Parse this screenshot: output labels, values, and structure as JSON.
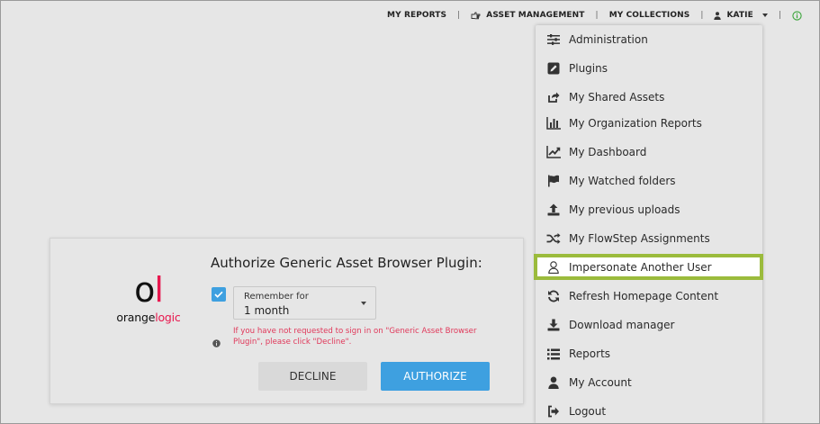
{
  "topnav": {
    "my_reports": "MY REPORTS",
    "asset_management": "ASSET MANAGEMENT",
    "my_collections": "MY COLLECTIONS",
    "user": "KATIE",
    "separator": "|"
  },
  "menu": {
    "items": [
      {
        "label": "Administration",
        "icon": "sliders-icon"
      },
      {
        "label": "Plugins",
        "icon": "pencil-icon"
      },
      {
        "label": "My Shared Assets",
        "icon": "share-icon"
      },
      {
        "label": "My Organization Reports",
        "icon": "bar-chart-icon"
      },
      {
        "label": "My Dashboard",
        "icon": "line-chart-icon"
      },
      {
        "label": "My Watched folders",
        "icon": "flag-icon"
      },
      {
        "label": "My previous uploads",
        "icon": "upload-icon"
      },
      {
        "label": "My FlowStep Assignments",
        "icon": "shuffle-icon"
      },
      {
        "label": "Impersonate Another User",
        "icon": "user-outline-icon"
      },
      {
        "label": "Refresh Homepage Content",
        "icon": "refresh-icon"
      },
      {
        "label": "Download manager",
        "icon": "download-icon"
      },
      {
        "label": "Reports",
        "icon": "list-icon"
      },
      {
        "label": "My Account",
        "icon": "user-icon"
      },
      {
        "label": "Logout",
        "icon": "logout-icon"
      }
    ]
  },
  "dialog": {
    "logo_mark_o": "o",
    "logo_mark_l": "l",
    "logo_word_a": "orange",
    "logo_word_b": "logic",
    "title": "Authorize Generic Asset Browser Plugin:",
    "remember_label": "Remember for",
    "remember_value": "1 month",
    "warning": "If you have not requested to sign in on \"Generic Asset Browser Plugin\", please click \"Decline\".",
    "decline": "DECLINE",
    "authorize": "AUTHORIZE"
  },
  "colors": {
    "accent": "#3ea0e0",
    "highlight": "#9bbb3c",
    "brand_pink": "#e8174e",
    "warning": "#e0385a",
    "status_green": "#3aa53a"
  }
}
